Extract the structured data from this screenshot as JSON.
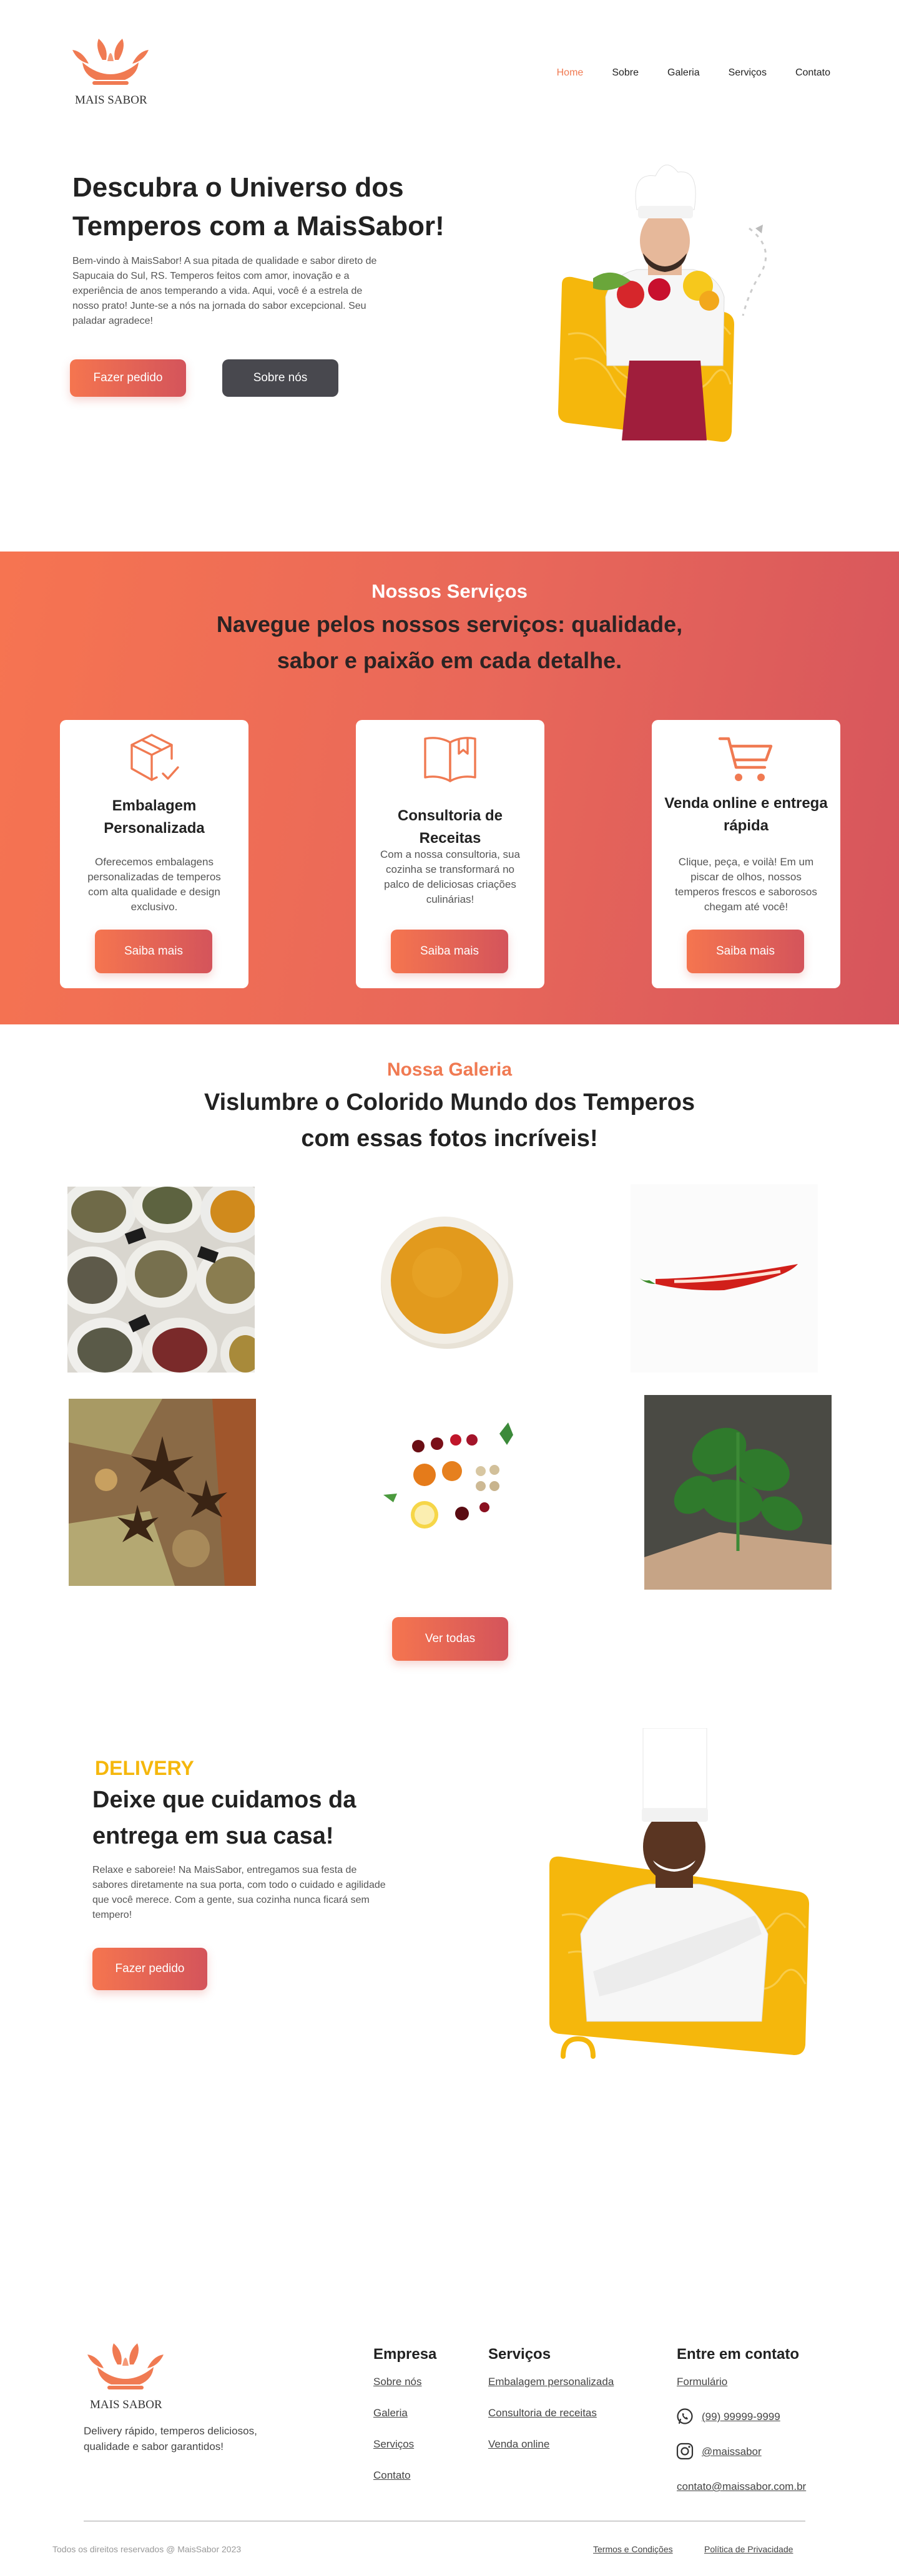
{
  "brand": {
    "name": "MAIS SABOR",
    "accent": "#f07a52",
    "accent_dark": "#d4545b",
    "yellow": "#f5b70c"
  },
  "nav": {
    "items": [
      {
        "label": "Home",
        "active": true
      },
      {
        "label": "Sobre",
        "active": false
      },
      {
        "label": "Galeria",
        "active": false
      },
      {
        "label": "Serviços",
        "active": false
      },
      {
        "label": "Contato",
        "active": false
      }
    ]
  },
  "hero": {
    "title": "Descubra o Universo dos Temperos com a MaisSabor!",
    "text": "Bem-vindo à MaisSabor! A sua pitada de qualidade e sabor direto de Sapucaia do Sul, RS. Temperos feitos com amor, inovação e a experiência de anos temperando a vida. Aqui, você é a estrela de nosso prato! Junte-se a nós na jornada do sabor excepcional. Seu paladar agradece!",
    "primary_button": "Fazer pedido",
    "secondary_button": "Sobre nós"
  },
  "services": {
    "eyebrow": "Nossos Serviços",
    "title": "Navegue pelos nossos serviços: qualidade, sabor e paixão em cada detalhe.",
    "cards": [
      {
        "icon": "package-check-icon",
        "title": "Embalagem Personalizada",
        "text": "Oferecemos embalagens personalizadas de temperos com alta qualidade e design exclusivo.",
        "button": "Saiba mais"
      },
      {
        "icon": "open-book-icon",
        "title": "Consultoria de Receitas",
        "text": "Com a nossa consultoria, sua cozinha se transformará no palco de deliciosas criações culinárias!",
        "button": "Saiba mais"
      },
      {
        "icon": "shopping-cart-icon",
        "title": "Venda online e entrega rápida",
        "text": "Clique, peça, e voilà! Em um piscar de olhos, nossos temperos frescos e saborosos chegam até você!",
        "button": "Saiba mais"
      }
    ]
  },
  "gallery": {
    "eyebrow": "Nossa Galeria",
    "title": "Vislumbre o Colorido Mundo dos Temperos com essas fotos incríveis!",
    "images": [
      "spice-sacks-photo",
      "turmeric-bowl-photo",
      "red-chili-photo",
      "star-anise-cinnamon-photo",
      "fruits-flatlay-photo",
      "basil-leaves-photo"
    ],
    "button": "Ver todas"
  },
  "delivery": {
    "eyebrow": "DELIVERY",
    "title": "Deixe que cuidamos da entrega em sua casa!",
    "text": "Relaxe e saboreie! Na MaisSabor, entregamos sua festa de sabores diretamente na sua porta, com todo o cuidado e agilidade que você merece. Com a gente, sua cozinha nunca ficará sem tempero!",
    "button": "Fazer pedido"
  },
  "footer": {
    "description": "Delivery rápido, temperos deliciosos, qualidade e sabor garantidos!",
    "columns": [
      {
        "title": "Empresa",
        "links": [
          "Sobre nós",
          "Galeria",
          "Serviços",
          "Contato"
        ]
      },
      {
        "title": "Serviços",
        "links": [
          "Embalagem personalizada",
          "Consultoria de receitas",
          "Venda online"
        ]
      }
    ],
    "contact": {
      "title": "Entre em contato",
      "form": "Formulário",
      "phone": "(99) 99999-9999",
      "instagram": "@maissabor",
      "email": "contato@maissabor.com.br"
    },
    "copyright": "Todos os direitos reservados @ MaisSabor 2023",
    "terms": "Termos e Condições",
    "privacy": "Política de Privacidade"
  }
}
